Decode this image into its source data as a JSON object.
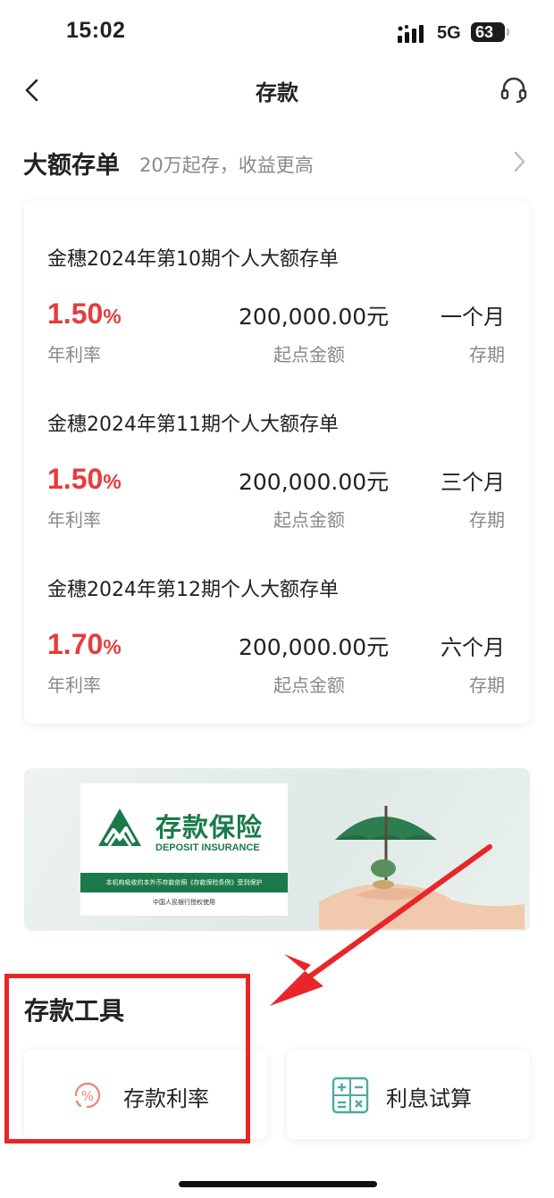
{
  "status_bar": {
    "time": "15:02",
    "network": "5G",
    "battery": "63"
  },
  "nav": {
    "title": "存款"
  },
  "large_deposit": {
    "title": "大额存单",
    "subtitle": "20万起存，收益更高",
    "products": [
      {
        "name": "金穗2024年第10期个人大额存单",
        "rate": "1.50",
        "rate_unit": "%",
        "rate_label": "年利率",
        "amount": "200,000.00元",
        "amount_label": "起点金额",
        "term": "一个月",
        "term_label": "存期"
      },
      {
        "name": "金穗2024年第11期个人大额存单",
        "rate": "1.50",
        "rate_unit": "%",
        "rate_label": "年利率",
        "amount": "200,000.00元",
        "amount_label": "起点金额",
        "term": "三个月",
        "term_label": "存期"
      },
      {
        "name": "金穗2024年第12期个人大额存单",
        "rate": "1.70",
        "rate_unit": "%",
        "rate_label": "年利率",
        "amount": "200,000.00元",
        "amount_label": "起点金额",
        "term": "六个月",
        "term_label": "存期"
      }
    ]
  },
  "banner": {
    "title": "存款保险",
    "subtitle_en": "DEPOSIT INSURANCE",
    "notice": "本机构吸收的本外币存款依照《存款保险条例》受到保护",
    "footer": "中国人民银行授权使用"
  },
  "tools": {
    "title": "存款工具",
    "items": [
      {
        "label": "存款利率",
        "icon": "percent-icon"
      },
      {
        "label": "利息试算",
        "icon": "calculator-icon"
      }
    ]
  },
  "colors": {
    "accent_red": "#e43d3d",
    "insurance_green": "#1b7a4a",
    "highlight": "#e8262a"
  }
}
